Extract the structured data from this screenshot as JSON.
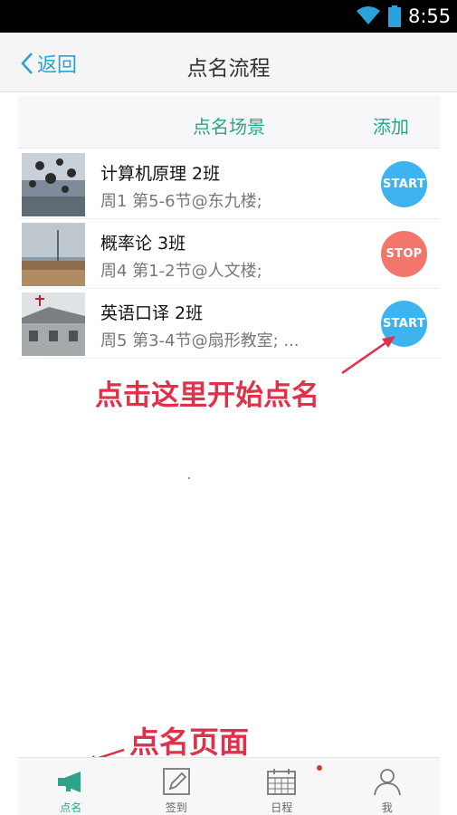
{
  "status_bar": {
    "time": "8:55"
  },
  "nav": {
    "back_label": "返回",
    "title": "点名流程"
  },
  "scene": {
    "title": "点名场景",
    "add_label": "添加"
  },
  "courses": [
    {
      "name": "计算机原理  2班",
      "info": "周1  第5-6节@东九楼;",
      "action": "START"
    },
    {
      "name": "概率论  3班",
      "info": "周4  第1-2节@人文楼;",
      "action": "STOP"
    },
    {
      "name": "英语口译  2班",
      "info": "周5  第3-4节@扇形教室; ...",
      "action": "START"
    }
  ],
  "annotations": {
    "start_hint": "点击这里开始点名",
    "page_hint": "点名页面"
  },
  "tabs": [
    {
      "label": "点名",
      "icon": "megaphone-icon",
      "active": true
    },
    {
      "label": "签到",
      "icon": "edit-icon",
      "active": false
    },
    {
      "label": "日程",
      "icon": "calendar-icon",
      "active": false
    },
    {
      "label": "我",
      "icon": "user-icon",
      "active": false
    }
  ],
  "colors": {
    "accent_green": "#2aa58a",
    "accent_blue": "#29a3d9",
    "start": "#3db3ef",
    "stop": "#f2766c",
    "annotation_red": "#e0304a"
  }
}
